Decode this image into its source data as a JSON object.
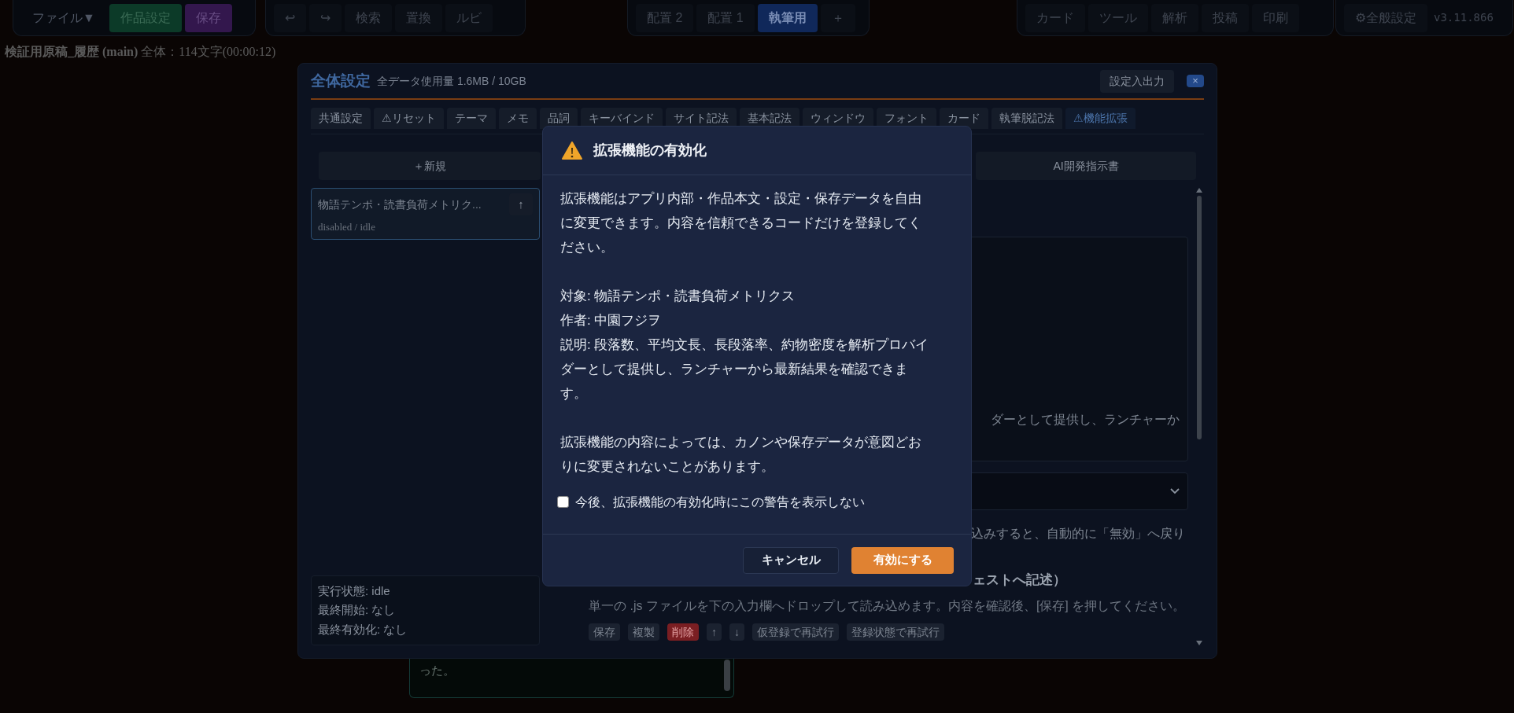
{
  "top_bar": {
    "groups": [
      {
        "buttons": [
          {
            "label": "ファイル▼",
            "kind": "menu"
          },
          {
            "label": "作品設定",
            "kind": "green"
          },
          {
            "label": "保存",
            "kind": "purple"
          }
        ]
      },
      {
        "buttons": [
          {
            "label": "↩",
            "kind": "plain"
          },
          {
            "label": "↪",
            "kind": "plain"
          },
          {
            "label": "検索",
            "kind": "plain"
          },
          {
            "label": "置換",
            "kind": "plain"
          },
          {
            "label": "ルビ",
            "kind": "plain"
          }
        ]
      },
      {
        "buttons": [
          {
            "label": "配置 2",
            "kind": "layout",
            "selected": false
          },
          {
            "label": "配置 1",
            "kind": "layout",
            "selected": false
          },
          {
            "label": "執筆用",
            "kind": "layout",
            "selected": true
          },
          {
            "label": "＋",
            "kind": "plain"
          }
        ]
      },
      {
        "buttons": [
          {
            "label": "カード",
            "kind": "plain"
          },
          {
            "label": "ツール",
            "kind": "plain"
          },
          {
            "label": "解析",
            "kind": "plain"
          },
          {
            "label": "投稿",
            "kind": "plain"
          },
          {
            "label": "印刷",
            "kind": "plain"
          }
        ]
      },
      {
        "buttons": [
          {
            "label": "⚙全般設定",
            "kind": "plain"
          }
        ],
        "version": "v3.11.866"
      }
    ]
  },
  "status_line": {
    "document": "検証用原稿_履歴 (main)",
    "stats": "全体：114文字(00:00:12)"
  },
  "settings": {
    "title": "全体設定",
    "usage": "全データ使用量 1.6MB / 10GB",
    "export_button": "設定入出力",
    "close_button": "×",
    "tabs": [
      {
        "label": "共通設定",
        "selected": false
      },
      {
        "label": "⚠リセット",
        "selected": false
      },
      {
        "label": "テーマ",
        "selected": false
      },
      {
        "label": "メモ",
        "selected": false
      },
      {
        "label": "品詞",
        "selected": false
      },
      {
        "label": "キーバインド",
        "selected": false
      },
      {
        "label": "サイト記法",
        "selected": false
      },
      {
        "label": "基本記法",
        "selected": false
      },
      {
        "label": "ウィンドウ",
        "selected": false
      },
      {
        "label": "フォント",
        "selected": false
      },
      {
        "label": "カード",
        "selected": false
      },
      {
        "label": "執筆脱記法",
        "selected": false
      },
      {
        "label": "⚠機能拡張",
        "selected": true
      }
    ],
    "new_button": "＋新規",
    "ai_button": "AI開発指示書",
    "extensions": [
      {
        "name": "物語テンポ・読書負荷メトリク...",
        "status": "disabled / idle",
        "move_up": "↑",
        "selected": true
      }
    ],
    "info": [
      "実行状態: idle",
      "最終開始: なし",
      "最終有効化: なし"
    ],
    "detail": {
      "description_tail": "ダーとして提供し、ランチャーか",
      "note_tail": "込みすると、自動的に「無効」へ戻り",
      "heading_tail": "ェストへ記述）",
      "import_hint": "単一の .js ファイルを下の入力欄へドロップして読み込めます。内容を確認後、[保存] を押してください。",
      "actions": [
        {
          "label": "保存",
          "kind": "default"
        },
        {
          "label": "複製",
          "kind": "default"
        },
        {
          "label": "削除",
          "kind": "danger"
        },
        {
          "label": "↑",
          "kind": "default"
        },
        {
          "label": "↓",
          "kind": "default"
        },
        {
          "label": "仮登録で再試行",
          "kind": "default"
        },
        {
          "label": "登録状態で再試行",
          "kind": "default"
        }
      ]
    }
  },
  "editor": {
    "text": "った。"
  },
  "dialog": {
    "title": "拡張機能の有効化",
    "paragraphs": [
      [
        "拡張機能はアプリ内部・作品本文・設定・保存データを自由に変更できます。内容を信頼できるコードだけを登録してください。"
      ],
      [
        "対象: 物語テンポ・読書負荷メトリクス",
        "作者: 中園フジヲ",
        "説明: 段落数、平均文長、長段落率、約物密度を解析プロバイダーとして提供し、ランチャーから最新結果を確認できます。"
      ],
      [
        "拡張機能の内容によっては、カノンや保存データが意図どおりに変更されないことがあります。"
      ]
    ],
    "checkbox": {
      "label": "今後、拡張機能の有効化時にこの警告を表示しない",
      "checked": false
    },
    "cancel_button": "キャンセル",
    "confirm_button": "有効にする"
  }
}
